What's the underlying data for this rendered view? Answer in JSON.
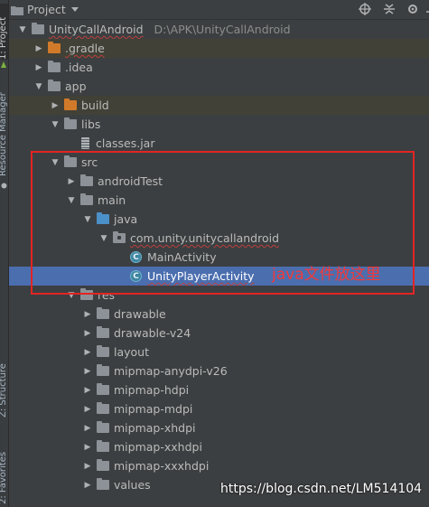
{
  "sidebar": {
    "tabs": [
      "1: Project",
      "Resource Manager",
      "Z: Structure",
      "2: Favorites"
    ]
  },
  "header": {
    "view_label": "Project",
    "icons": [
      "target-icon",
      "collapse-icon",
      "gear-icon",
      "minimize-icon"
    ]
  },
  "tree": [
    {
      "label": "UnityCallAndroid",
      "path": "D:\\APK\\UnityCallAndroid",
      "icon": "folder-gray",
      "arrow": "down",
      "squiggle": true
    },
    {
      "label": ".gradle",
      "icon": "folder-orange",
      "arrow": "right",
      "squiggle": true
    },
    {
      "label": ".idea",
      "icon": "folder-gray",
      "arrow": "right"
    },
    {
      "label": "app",
      "icon": "folder-gray",
      "arrow": "down"
    },
    {
      "label": "build",
      "icon": "folder-orange",
      "arrow": "right"
    },
    {
      "label": "libs",
      "icon": "folder-gray",
      "arrow": "down"
    },
    {
      "label": "classes.jar",
      "icon": "jar"
    },
    {
      "label": "src",
      "icon": "folder-gray",
      "arrow": "down"
    },
    {
      "label": "androidTest",
      "icon": "folder-gray",
      "arrow": "right"
    },
    {
      "label": "main",
      "icon": "folder-gray",
      "arrow": "down"
    },
    {
      "label": "java",
      "icon": "folder-blue",
      "arrow": "down"
    },
    {
      "label": "com.unity.unitycallandroid",
      "icon": "package",
      "arrow": "down",
      "squiggle": true
    },
    {
      "label": "MainActivity",
      "icon": "class"
    },
    {
      "label": "UnityPlayerActivity",
      "icon": "class",
      "selected": true,
      "squiggle": true
    },
    {
      "label": "res",
      "icon": "folder-gray",
      "arrow": "down"
    },
    {
      "label": "drawable",
      "icon": "folder-gray",
      "arrow": "right"
    },
    {
      "label": "drawable-v24",
      "icon": "folder-gray",
      "arrow": "right"
    },
    {
      "label": "layout",
      "icon": "folder-gray",
      "arrow": "right"
    },
    {
      "label": "mipmap-anydpi-v26",
      "icon": "folder-gray",
      "arrow": "right"
    },
    {
      "label": "mipmap-hdpi",
      "icon": "folder-gray",
      "arrow": "right"
    },
    {
      "label": "mipmap-mdpi",
      "icon": "folder-gray",
      "arrow": "right"
    },
    {
      "label": "mipmap-xhdpi",
      "icon": "folder-gray",
      "arrow": "right"
    },
    {
      "label": "mipmap-xxhdpi",
      "icon": "folder-gray",
      "arrow": "right"
    },
    {
      "label": "mipmap-xxxhdpi",
      "icon": "folder-gray",
      "arrow": "right"
    },
    {
      "label": "values",
      "icon": "folder-gray",
      "arrow": "right"
    }
  ],
  "annotation": "java文件放这里",
  "watermark": "https://blog.csdn.net/LM514104",
  "colors": {
    "background": "#3c3f41",
    "selection": "#4b6eaf",
    "annotation": "#e32424"
  }
}
